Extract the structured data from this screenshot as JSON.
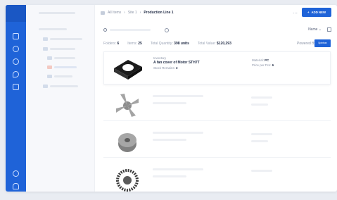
{
  "breadcrumb": [
    "All Items",
    "Site 1",
    "Production Line 1"
  ],
  "toolbar": {
    "add_label": "ADD NEW",
    "menu_glyph": "⋯"
  },
  "search": {
    "sort_label": "Name"
  },
  "stats": [
    {
      "label": "Folders:",
      "value": "6"
    },
    {
      "label": "Items:",
      "value": "25"
    },
    {
      "label": "Total Quantity:",
      "value": "398 units"
    },
    {
      "label": "Total Value:",
      "value": "$120,293"
    }
  ],
  "branding": {
    "powered_by": "Powered By",
    "logo_text": "Spintrax"
  },
  "items": [
    {
      "category": "Inventory",
      "name": "A fan cover of Motor STH7T",
      "stock_label": "Stock Remains:",
      "stock_value": "3",
      "material_label": "Material:",
      "material_value": "PC",
      "price_label": "Price per Pcs:",
      "price_value": "6"
    }
  ],
  "icons": {
    "rail": [
      "home-icon",
      "package-icon",
      "search-icon",
      "tag-icon",
      "calendar-icon",
      "help-icon",
      "bell-icon"
    ],
    "accent": "#1f63d8"
  }
}
